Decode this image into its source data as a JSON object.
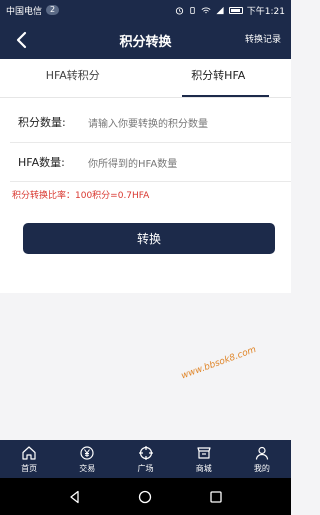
{
  "status_bar": {
    "carrier": "中国电信",
    "badge": "2",
    "time": "下午1:21"
  },
  "header": {
    "title": "积分转换",
    "right_link": "转换记录"
  },
  "tabs": [
    {
      "label": "HFA转积分",
      "active": false
    },
    {
      "label": "积分转HFA",
      "active": true
    }
  ],
  "form": {
    "points_label": "积分数量:",
    "points_placeholder": "请输入你要转换的积分数量",
    "hfa_label": "HFA数量:",
    "hfa_placeholder": "你所得到的HFA数量",
    "rate_text": "积分转换比率：100积分=0.7HFA",
    "convert_button": "转换"
  },
  "watermark": "www.bbsok8.com",
  "tab_bar": {
    "items": [
      {
        "label": "首页",
        "icon": "home-icon"
      },
      {
        "label": "交易",
        "icon": "yen-coin-icon"
      },
      {
        "label": "广场",
        "icon": "crosshair-icon"
      },
      {
        "label": "商城",
        "icon": "store-icon"
      },
      {
        "label": "我的",
        "icon": "user-icon"
      }
    ]
  },
  "colors": {
    "primary": "#1c2a4a",
    "rate_red": "#d9372f",
    "background": "#f4f4f6"
  }
}
